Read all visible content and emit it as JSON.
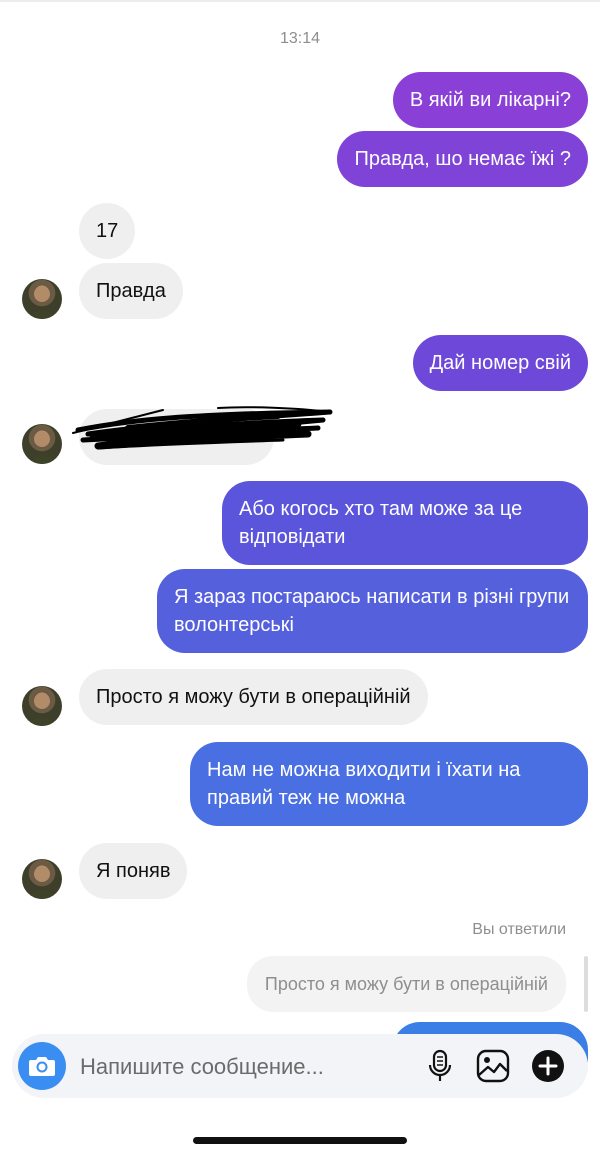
{
  "chat": {
    "timestamp": "13:14",
    "messages": [
      {
        "dir": "out",
        "text": "В якій ви лікарні?",
        "color": "#8a3fd6"
      },
      {
        "dir": "out",
        "text": "Правда, шо немає їжі ?",
        "color": "#7f43d8"
      },
      {
        "dir": "in",
        "text": "17"
      },
      {
        "dir": "in",
        "text": "Правда"
      },
      {
        "dir": "out",
        "text": "Дай номер свій",
        "color": "#6e49d9"
      },
      {
        "dir": "in",
        "text": "",
        "redacted": true
      },
      {
        "dir": "out",
        "text": "Або когось хто там може за це відповідати",
        "color": "#5b55dc"
      },
      {
        "dir": "out",
        "text": "Я зараз постараюсь написати в різні групи волонтерські",
        "color": "#5560dd"
      },
      {
        "dir": "in",
        "text": "Просто я можу бути в операційній"
      },
      {
        "dir": "out",
        "text": "Нам не можна виходити і їхати на правий теж не можна",
        "color": "#4a6fe2"
      },
      {
        "dir": "in",
        "text": "Я поняв"
      }
    ],
    "replied_label": "Вы ответили",
    "reply_quote": "Просто я можу бути в операційній"
  },
  "composer": {
    "placeholder": "Напишите сообщение...",
    "camera_icon": "camera-icon",
    "mic_icon": "microphone-icon",
    "gallery_icon": "gallery-icon",
    "plus_icon": "plus-icon"
  }
}
